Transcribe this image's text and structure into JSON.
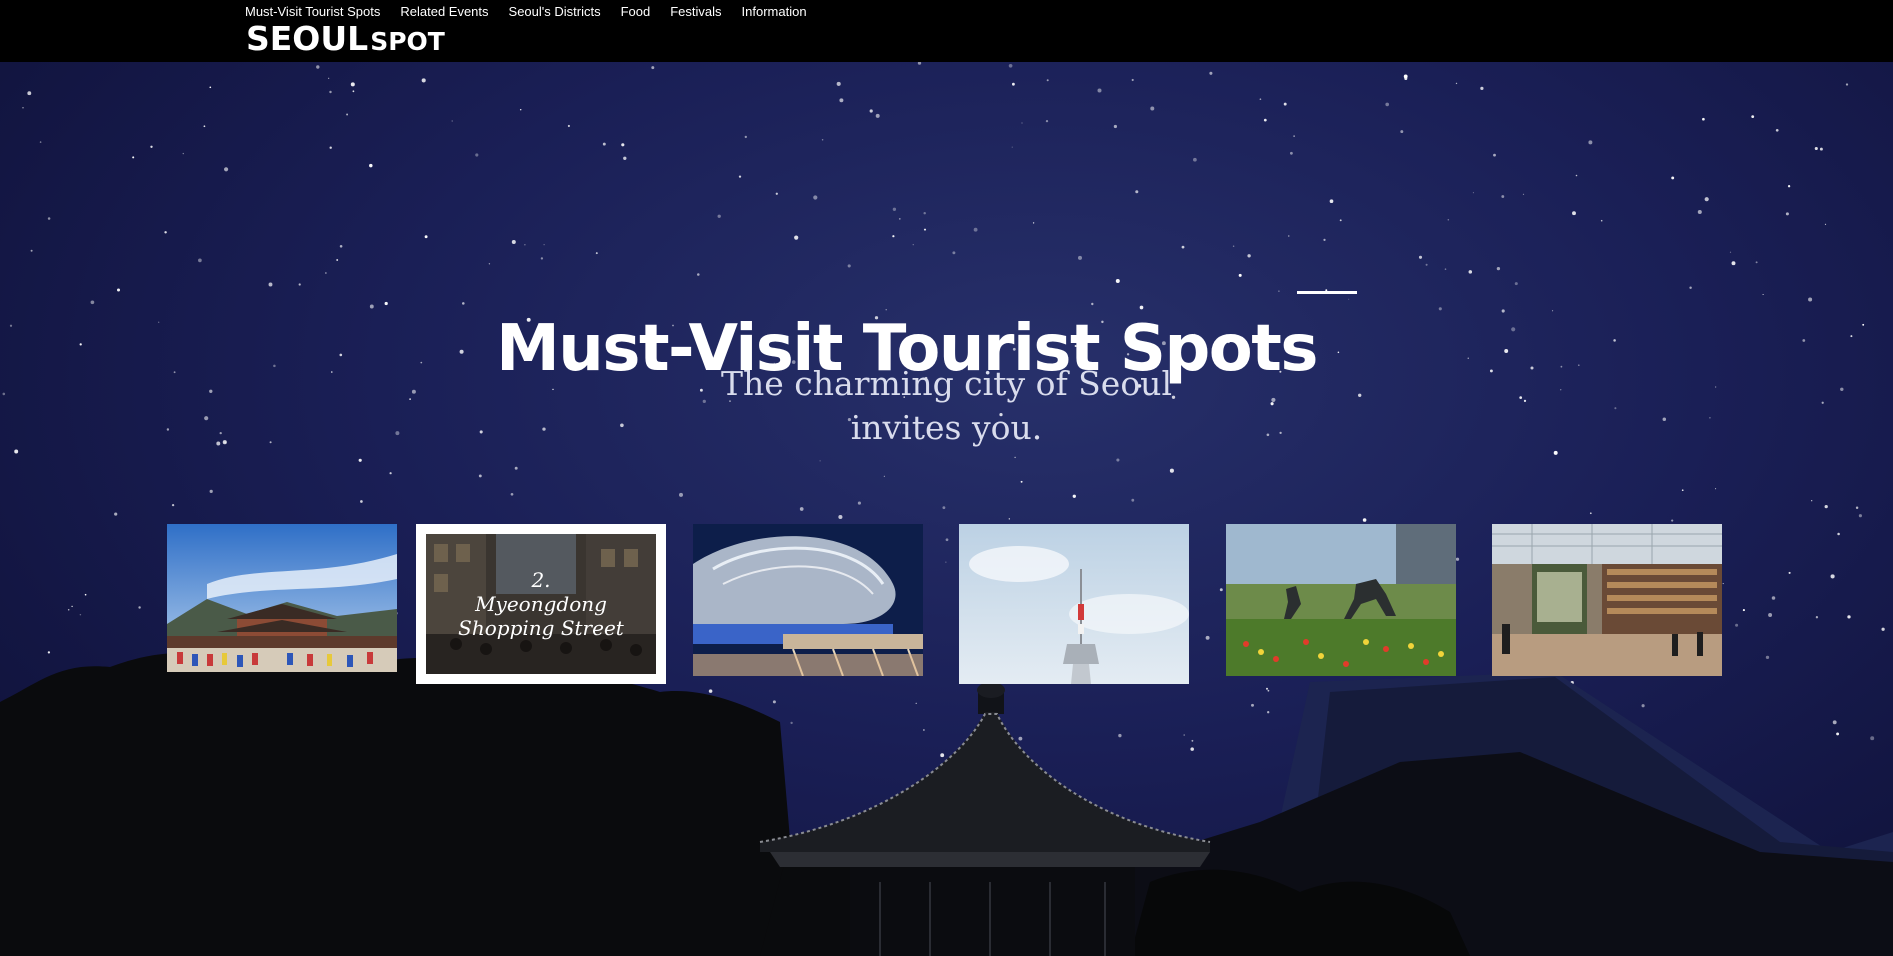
{
  "header": {
    "nav": [
      "Must-Visit Tourist Spots",
      "Related Events",
      "Seoul's Districts",
      "Food",
      "Festivals",
      "Information"
    ],
    "logo_main": "SEOUL",
    "logo_sub": "SPOT",
    "background_color": "#000000"
  },
  "hero": {
    "title": "Must-Visit Tourist Spots",
    "subtitle_line1": "The charming city of Seoul",
    "subtitle_line2": "invites you.",
    "background_color": "#1a1f56"
  },
  "cards": [
    {
      "subject": "palace-icon"
    },
    {
      "number": "2.",
      "title": "Myeongdong Shopping Street",
      "selected": true
    },
    {
      "subject": "plaza-icon"
    },
    {
      "subject": "tower-icon"
    },
    {
      "subject": "statue-park-icon"
    },
    {
      "subject": "library-mall-icon"
    }
  ]
}
